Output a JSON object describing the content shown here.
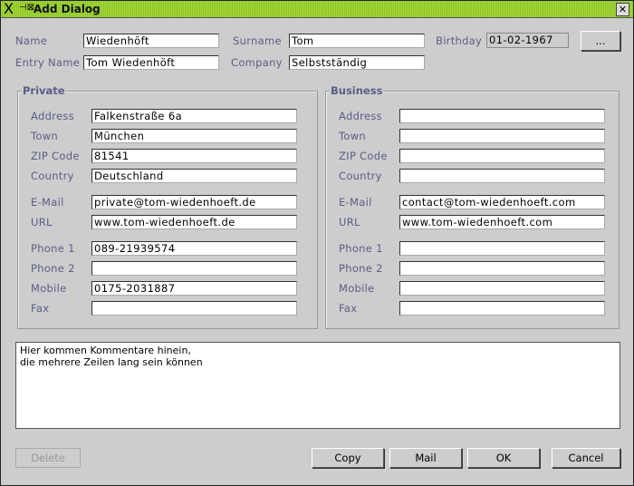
{
  "window": {
    "title": "Add Dialog"
  },
  "header": {
    "name_label": "Name",
    "name": "Wiedenhöft",
    "surname_label": "Surname",
    "surname": "Tom",
    "birthday_label": "Birthday",
    "birthday": "01-02-1967",
    "date_button": "...",
    "entry_label": "Entry Name",
    "entry": "Tom Wiedenhöft",
    "company_label": "Company",
    "company": "Selbstständig"
  },
  "labels": [
    "Address",
    "Town",
    "ZIP Code",
    "Country",
    "E-Mail",
    "URL",
    "Phone 1",
    "Phone 2",
    "Mobile",
    "Fax"
  ],
  "private": {
    "title": "Private",
    "values": [
      "Falkenstraße 6a",
      "München",
      "81541",
      "Deutschland",
      "private@tom-wiedenhoeft.de",
      "www.tom-wiedenhoeft.de",
      "089-21939574",
      "",
      "0175-2031887",
      ""
    ]
  },
  "business": {
    "title": "Business",
    "values": [
      "",
      "",
      "",
      "",
      "contact@tom-wiedenhoeft.com",
      "www.tom-wiedenhoeft.com",
      "",
      "",
      "",
      ""
    ]
  },
  "comments": "Hier kommen Kommentare hinein,\ndie mehrere Zeilen lang sein können",
  "buttons": {
    "delete": "Delete",
    "copy": "Copy",
    "mail": "Mail",
    "ok": "OK",
    "cancel": "Cancel"
  }
}
